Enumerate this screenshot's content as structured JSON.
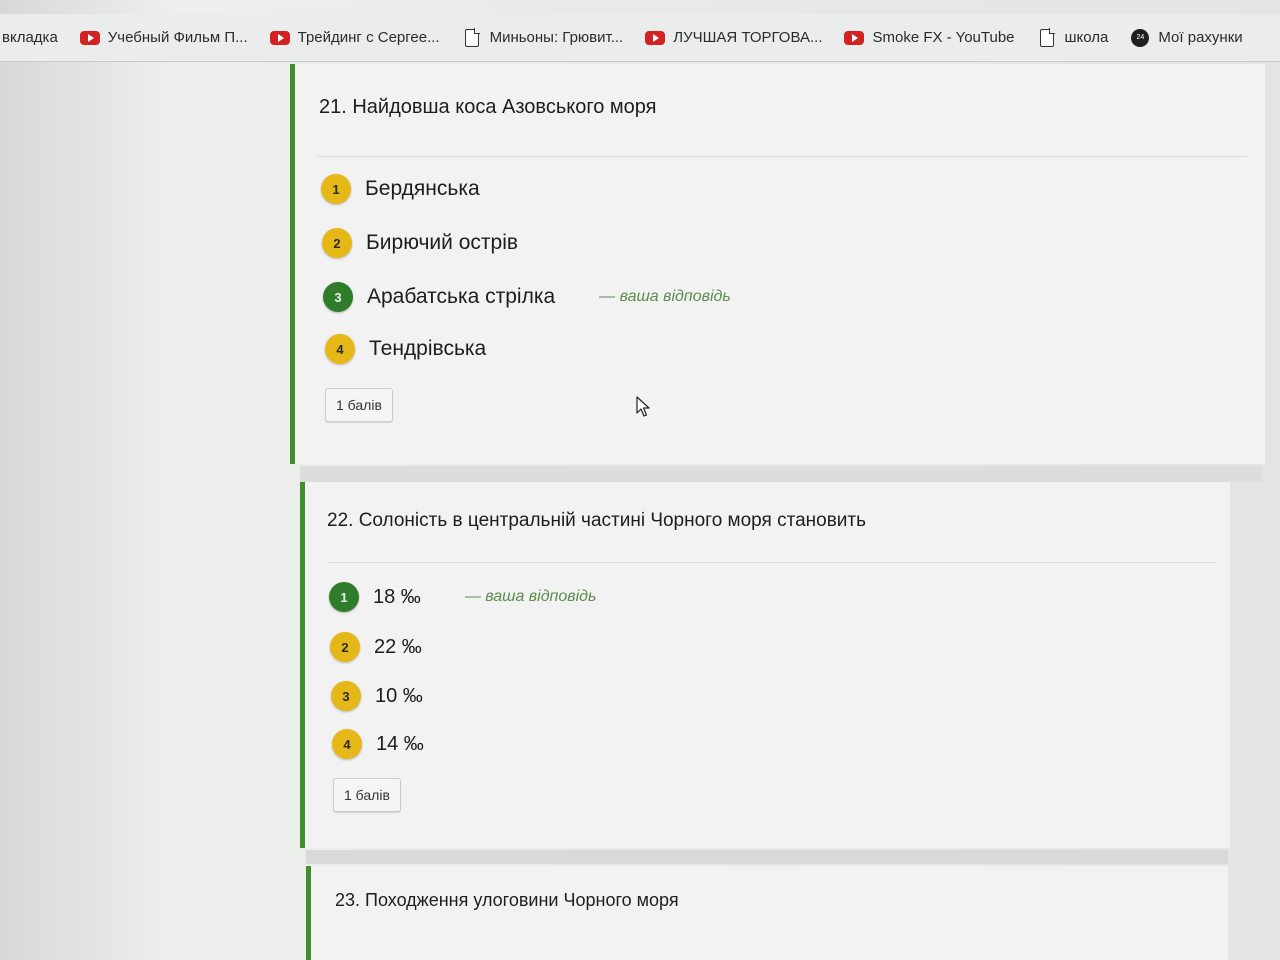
{
  "bookmarks": [
    {
      "label": "вкладка",
      "icon": "none"
    },
    {
      "label": "Учебный Фильм П...",
      "icon": "youtube-icon"
    },
    {
      "label": "Трейдинг с Сергее...",
      "icon": "youtube-icon"
    },
    {
      "label": "Миньоны: Грювит...",
      "icon": "document-icon"
    },
    {
      "label": "ЛУЧШАЯ ТОРГОВА...",
      "icon": "youtube-icon"
    },
    {
      "label": "Smoke FX - YouTube",
      "icon": "youtube-icon"
    },
    {
      "label": "школа",
      "icon": "document-icon"
    },
    {
      "label": "Мої рахунки",
      "icon": "circle-icon"
    }
  ],
  "questions": [
    {
      "title": "21. Найдовша коса Азовського моря",
      "options": [
        {
          "num": "1",
          "label": "Бердянська",
          "status": "yellow"
        },
        {
          "num": "2",
          "label": "Бирючий острів",
          "status": "yellow"
        },
        {
          "num": "3",
          "label": "Арабатська стрілка",
          "status": "green",
          "note": "— ваша відповідь"
        },
        {
          "num": "4",
          "label": "Тендрівська",
          "status": "yellow"
        }
      ],
      "score": "1 балів"
    },
    {
      "title": "22. Солоність в центральній частині Чорного моря становить",
      "options": [
        {
          "num": "1",
          "label": "18 ‰",
          "status": "green",
          "note": "— ваша відповідь"
        },
        {
          "num": "2",
          "label": "22 ‰",
          "status": "yellow"
        },
        {
          "num": "3",
          "label": "10 ‰",
          "status": "yellow"
        },
        {
          "num": "4",
          "label": "14 ‰",
          "status": "yellow"
        }
      ],
      "score": "1 балів"
    },
    {
      "title": "23. Походження улоговини Чорного моря"
    }
  ],
  "colors": {
    "accent_green": "#3f8f2f",
    "correct_badge": "#2f7d2a",
    "option_badge": "#e6b817",
    "note_text": "#5a8d4b"
  }
}
